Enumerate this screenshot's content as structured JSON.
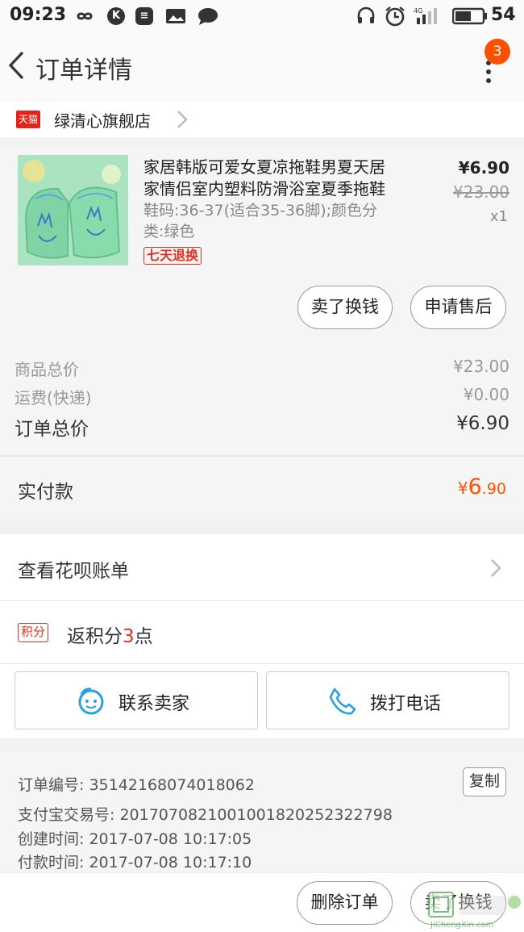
{
  "status_bar": {
    "time": "09:23",
    "battery": "54",
    "network": "4G"
  },
  "header": {
    "title": "订单详情",
    "badge_count": "3"
  },
  "shop": {
    "badge": "天猫",
    "name": "绿清心旗舰店"
  },
  "item": {
    "title_line1": "家居韩版可爱女夏凉拖鞋男夏天居",
    "title_line2": "家情侣室内塑料防滑浴室夏季拖鞋",
    "spec_line1": "鞋码:36-37(适合35-36脚);颜色分",
    "spec_line2": "类:绿色",
    "tag": "七天退换",
    "price": "¥6.90",
    "original_price": "¥23.00",
    "quantity": "x1",
    "btn_sell": "卖了换钱",
    "btn_aftersale": "申请售后"
  },
  "fees": {
    "goods_label": "商品总价",
    "goods_value": "¥23.00",
    "shipping_label": "运费(快递)",
    "shipping_value": "¥0.00",
    "total_label": "订单总价",
    "total_value": "¥6.90"
  },
  "paid": {
    "label": "实付款",
    "currency": "¥",
    "int_part": "6",
    "dec_part": ".90"
  },
  "huabei": {
    "label": "查看花呗账单"
  },
  "points": {
    "badge": "积分",
    "prefix": "返积分",
    "count": "3",
    "suffix": "点"
  },
  "actions": {
    "contact_seller": "联系卖家",
    "call": "拨打电话"
  },
  "order_info": {
    "order_no": "订单编号: 35142168074018062",
    "copy_label": "复制",
    "alipay_no": "支付宝交易号: 2017070821001001820252322798",
    "created": "创建时间: 2017-07-08 10:17:05",
    "paid_time": "付款时间: 2017-07-08 10:17:10"
  },
  "bottom": {
    "delete": "删除订单",
    "sell": "卖了换钱"
  },
  "watermark": {
    "text": "JiChengXin.com"
  },
  "colors": {
    "accent": "#ff5000",
    "tmall_red": "#e2231a",
    "points_red": "#e0301e",
    "brand_blue": "#28a0e6"
  }
}
